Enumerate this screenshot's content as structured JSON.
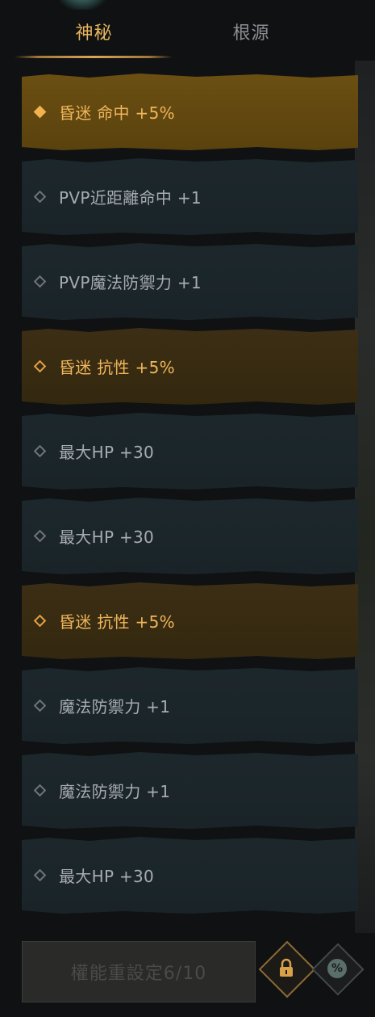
{
  "tabs": {
    "mystic": "神秘",
    "origin": "根源"
  },
  "options": [
    {
      "label": "昏迷 命中 +5%",
      "rarity": "gold",
      "selected": true
    },
    {
      "label": "PVP近距離命中 +1",
      "rarity": "normal"
    },
    {
      "label": "PVP魔法防禦力 +1",
      "rarity": "normal"
    },
    {
      "label": "昏迷 抗性 +5%",
      "rarity": "gold"
    },
    {
      "label": "最大HP +30",
      "rarity": "normal"
    },
    {
      "label": "最大HP +30",
      "rarity": "normal"
    },
    {
      "label": "昏迷 抗性 +5%",
      "rarity": "gold"
    },
    {
      "label": "魔法防禦力 +1",
      "rarity": "normal"
    },
    {
      "label": "魔法防禦力 +1",
      "rarity": "normal"
    },
    {
      "label": "最大HP +30",
      "rarity": "normal"
    }
  ],
  "bottom": {
    "reset_label": "權能重設定6/10",
    "lock_icon": "lock-icon",
    "percent_icon": "percent-icon",
    "percent_glyph": "%"
  },
  "colors": {
    "gold": "#f0b65a",
    "normal_text": "#a7acaf",
    "tab_active": "#e7b55a"
  }
}
